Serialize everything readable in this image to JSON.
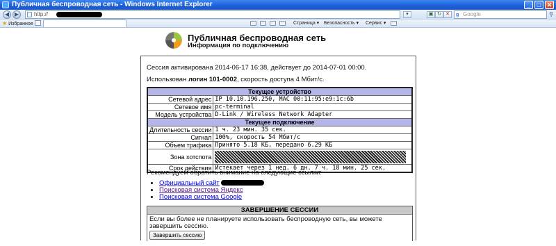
{
  "browser": {
    "window_title": "Публичная беспроводная сеть - Windows Internet Explorer",
    "address_prefix": "http://",
    "search_placeholder": "Google",
    "favorites_label": "Избранное",
    "menu": {
      "page": "Страница ▾",
      "security": "Безопасность ▾",
      "service": "Сервис ▾"
    },
    "window_buttons": {
      "minimize": "_",
      "maximize": "□",
      "close": "✕"
    }
  },
  "header": {
    "title": "Публичная беспроводная сеть",
    "subtitle": "Информация по подключению"
  },
  "session": {
    "activated_line": "Сессия активирована 2014-06-17 16:38, действует до 2014-07-01 00:00.",
    "login_prefix": "Использован ",
    "login_value": "логин 101-0002",
    "login_suffix": ", скорость доступа 4 Мбит/с."
  },
  "device": {
    "header": "Текущее устройство",
    "rows": [
      {
        "label": "Сетевой адрес",
        "value": "IP 10.10.196.250, MAC 00:11:95:e9:1c:6b"
      },
      {
        "label": "Сетевое имя",
        "value": "pc-terminal"
      },
      {
        "label": "Модель устройства",
        "value": "D-Link / Wireless Network Adapter"
      }
    ]
  },
  "connection": {
    "header": "Текущее подключение",
    "duration_label": "Длительность сессии",
    "duration_value": "1 ч. 23 мин. 35 сек.",
    "signal_label": "Сигнал",
    "signal_value": "100%, скорость 54 Мбит/с",
    "traffic_label": "Объем трафика",
    "traffic_value": "Принято 5.18 КБ, передано 6.29 КБ",
    "hotspot_label": "Зона хотспота",
    "expiry_label": "Срок действия",
    "expiry_value": "Истекает через 1 нед. 6 дн. 7 ч. 18 мин. 25 сек."
  },
  "recommend": {
    "text": "Рекомендуем обратить внимание на следующие ссылки:",
    "links": [
      {
        "label": "Официальный сайт"
      },
      {
        "label": "Поисковая система Яндекс"
      },
      {
        "label": "Поисковая система Google"
      }
    ]
  },
  "end_session": {
    "header": "ЗАВЕРШЕНИЕ СЕССИИ",
    "text": "Если вы более не планируете использовать беспроводную сеть, вы можете завершить сессию.",
    "button_label": "Завершить сессию"
  },
  "colors": {
    "table_header_bg": "#b3b6e6",
    "end_header_bg": "#c8c8c8",
    "link": "#0000ee",
    "link_visited": "#551a8b"
  }
}
